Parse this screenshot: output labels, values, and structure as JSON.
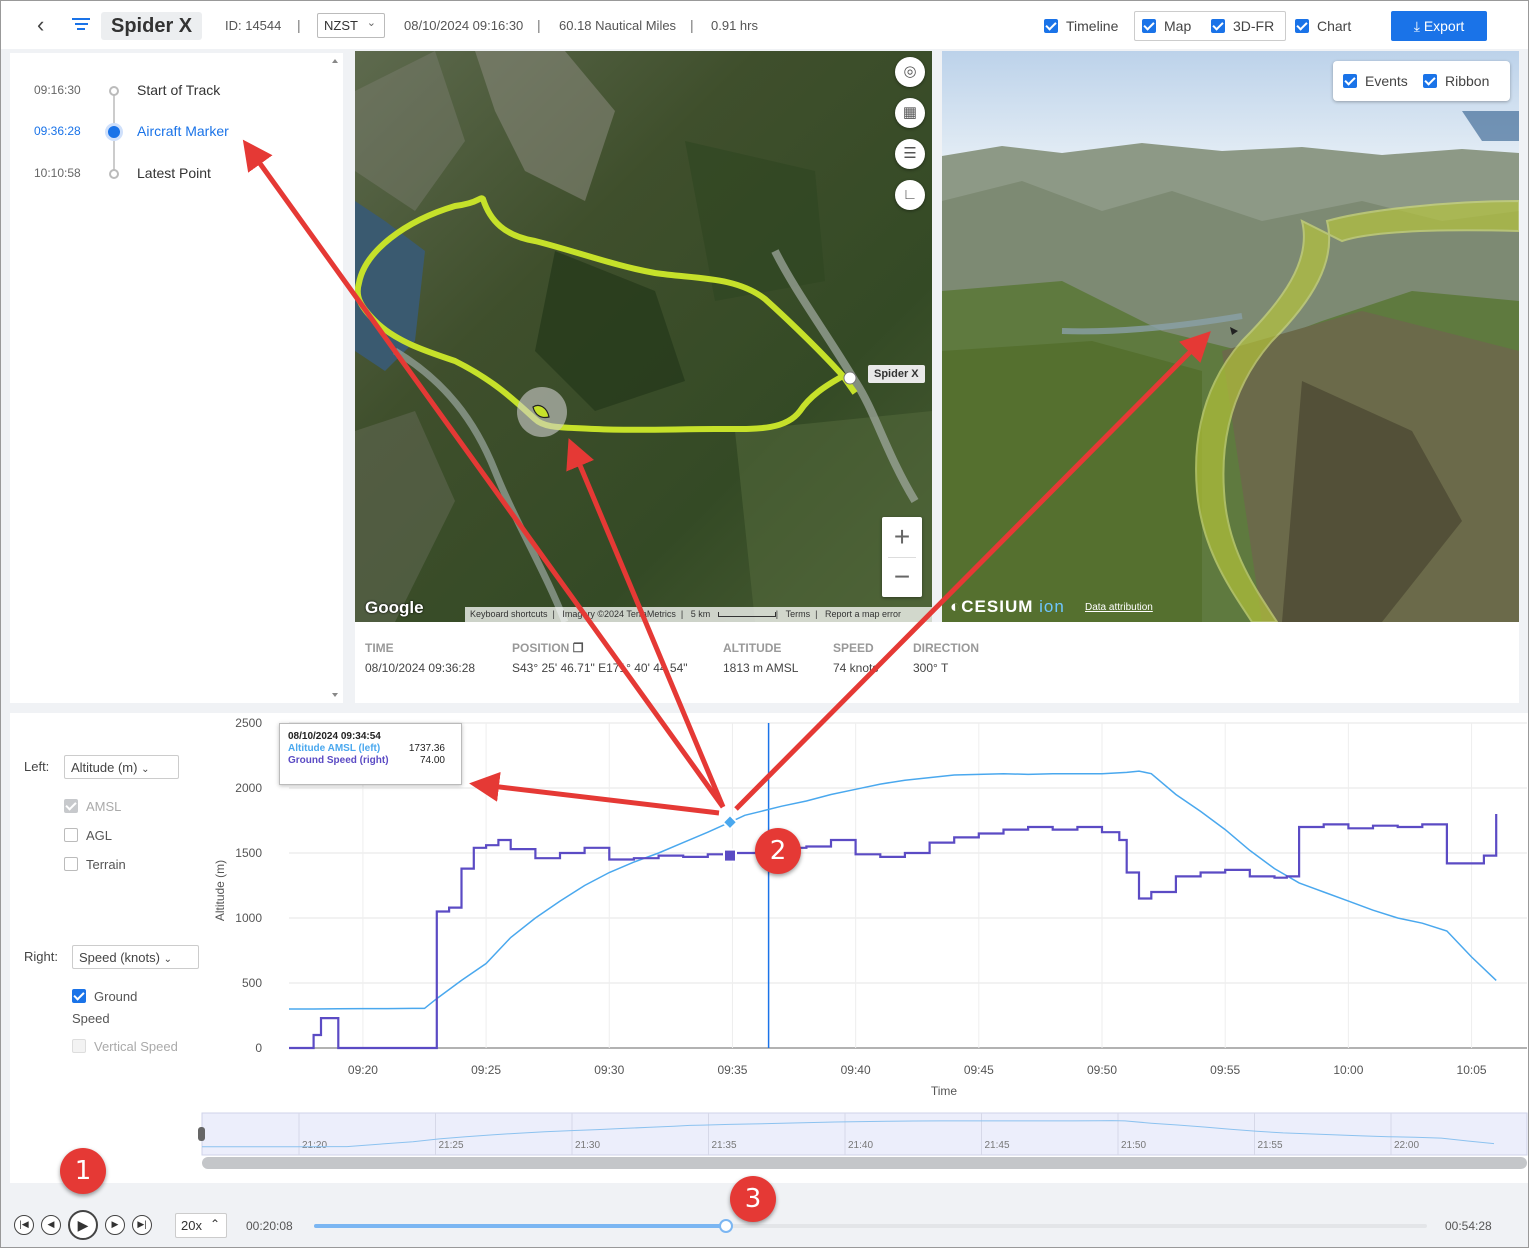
{
  "header": {
    "title": "Spider X",
    "id_text": "ID: 14544",
    "timezone": "NZST",
    "datetime": "08/10/2024 09:16:30",
    "distance": "60.18 Nautical Miles",
    "duration": "0.91 hrs",
    "toggles": {
      "timeline": "Timeline",
      "map": "Map",
      "fr3d": "3D-FR",
      "chart": "Chart"
    },
    "export_label": "Export"
  },
  "timeline": {
    "items": [
      {
        "time": "09:16:30",
        "label": "Start of Track"
      },
      {
        "time": "09:36:28",
        "label": "Aircraft Marker"
      },
      {
        "time": "10:10:58",
        "label": "Latest Point"
      }
    ]
  },
  "map2d": {
    "aircraft_label": "Spider X",
    "google": "Google",
    "footer": {
      "shortcuts": "Keyboard shortcuts",
      "imagery": "Imagery ©2024 TerraMetrics",
      "scale": "5 km",
      "terms": "Terms",
      "report": "Report a map error"
    }
  },
  "map3d": {
    "events_label": "Events",
    "ribbon_label": "Ribbon",
    "cesium": "CESIUM",
    "cesium_ion": "ion",
    "attribution": "Data attribution"
  },
  "info": {
    "time_label": "TIME",
    "time_value": "08/10/2024 09:36:28",
    "position_label": "POSITION",
    "position_value": "S43° 25' 46.71\" E171° 40' 44.54\"",
    "altitude_label": "ALTITUDE",
    "altitude_value": "1813 m AMSL",
    "speed_label": "SPEED",
    "speed_value": "74 knots",
    "direction_label": "DIRECTION",
    "direction_value": "300° T"
  },
  "chart_controls": {
    "left_label": "Left:",
    "left_select": "Altitude (m)",
    "amsl": "AMSL",
    "agl": "AGL",
    "terrain": "Terrain",
    "right_label": "Right:",
    "right_select": "Speed (knots)",
    "ground": "Ground",
    "speed_word": "Speed",
    "vertical_speed": "Vertical Speed"
  },
  "tooltip": {
    "title": "08/10/2024 09:34:54",
    "altitude_name": "Altitude AMSL (left)",
    "altitude_value": "1737.36",
    "speed_name": "Ground Speed (right)",
    "speed_value": "74.00"
  },
  "chart_data": {
    "type": "line",
    "xlabel": "Time",
    "ylabel": "Altitude (m)",
    "ylim": [
      0,
      2500
    ],
    "yticks": [
      0,
      500,
      1000,
      1500,
      2000,
      2500
    ],
    "xticks": [
      "09:20",
      "09:25",
      "09:30",
      "09:35",
      "09:40",
      "09:45",
      "09:50",
      "09:55",
      "10:00",
      "10:05"
    ],
    "cursor_time": "09:36:28",
    "colors": {
      "altitude": "#4aa8ee",
      "speed": "#5b4bc4",
      "cursor": "#1a73e8"
    },
    "series": [
      {
        "name": "Altitude AMSL (left)",
        "x": [
          17.0,
          18.0,
          19.0,
          20.0,
          21.0,
          22.0,
          22.5,
          23.0,
          24.0,
          25.0,
          26.0,
          27.0,
          28.0,
          29.0,
          30.0,
          31.0,
          32.0,
          33.0,
          34.0,
          34.9,
          35.5,
          36.0,
          37.0,
          38.0,
          39.0,
          40.0,
          41.0,
          42.0,
          43.0,
          44.0,
          45.0,
          46.0,
          47.0,
          48.0,
          49.0,
          50.0,
          51.0,
          51.5,
          52.0,
          53.0,
          54.0,
          55.0,
          56.0,
          57.0,
          58.0,
          59.0,
          60.0,
          61.0,
          62.0,
          63.0,
          64.0,
          65.0,
          66.0
        ],
        "values": [
          300,
          300,
          302,
          303,
          303,
          305,
          305,
          380,
          520,
          650,
          850,
          1000,
          1130,
          1250,
          1350,
          1430,
          1500,
          1580,
          1660,
          1737,
          1790,
          1813,
          1860,
          1900,
          1950,
          1990,
          2030,
          2060,
          2080,
          2100,
          2105,
          2110,
          2105,
          2110,
          2110,
          2110,
          2120,
          2130,
          2110,
          1950,
          1820,
          1680,
          1520,
          1380,
          1270,
          1200,
          1130,
          1060,
          1000,
          960,
          900,
          700,
          520
        ]
      },
      {
        "name": "Ground Speed (right)",
        "x": [
          17.0,
          17.7,
          18.0,
          18.3,
          18.6,
          19.0,
          20.0,
          21.0,
          22.0,
          22.3,
          22.5,
          23.0,
          23.5,
          24.0,
          24.5,
          25.0,
          25.5,
          26.0,
          27.0,
          28.0,
          29.0,
          30.0,
          31.0,
          32.0,
          33.0,
          34.0,
          35.0,
          36.0,
          37.0,
          38.0,
          39.0,
          40.0,
          41.0,
          42.0,
          43.0,
          44.0,
          45.0,
          46.0,
          47.0,
          48.0,
          49.0,
          50.0,
          50.7,
          51.0,
          51.5,
          52.0,
          53.0,
          54.0,
          55.0,
          56.0,
          57.0,
          57.5,
          58.0,
          59.0,
          60.0,
          61.0,
          62.0,
          63.0,
          64.0,
          65.0,
          65.5,
          66.0
        ],
        "values": [
          0,
          0,
          100,
          230,
          230,
          0,
          0,
          0,
          0,
          0,
          0,
          1050,
          1080,
          1380,
          1540,
          1560,
          1600,
          1530,
          1460,
          1500,
          1540,
          1450,
          1460,
          1480,
          1470,
          1490,
          1500,
          1510,
          1540,
          1550,
          1600,
          1490,
          1470,
          1500,
          1580,
          1620,
          1650,
          1680,
          1700,
          1680,
          1700,
          1660,
          1600,
          1350,
          1150,
          1200,
          1320,
          1350,
          1370,
          1320,
          1310,
          1320,
          1700,
          1720,
          1690,
          1710,
          1700,
          1720,
          1420,
          1420,
          1480,
          1800
        ]
      }
    ],
    "navigator_ticks": [
      "21:20",
      "21:25",
      "21:30",
      "21:35",
      "21:40",
      "21:45",
      "21:50",
      "21:55",
      "22:00"
    ]
  },
  "playback": {
    "speed": "20x",
    "elapsed": "00:20:08",
    "total": "00:54:28",
    "progress": 0.37
  },
  "badges": {
    "one": "1",
    "two": "2",
    "three": "3"
  }
}
